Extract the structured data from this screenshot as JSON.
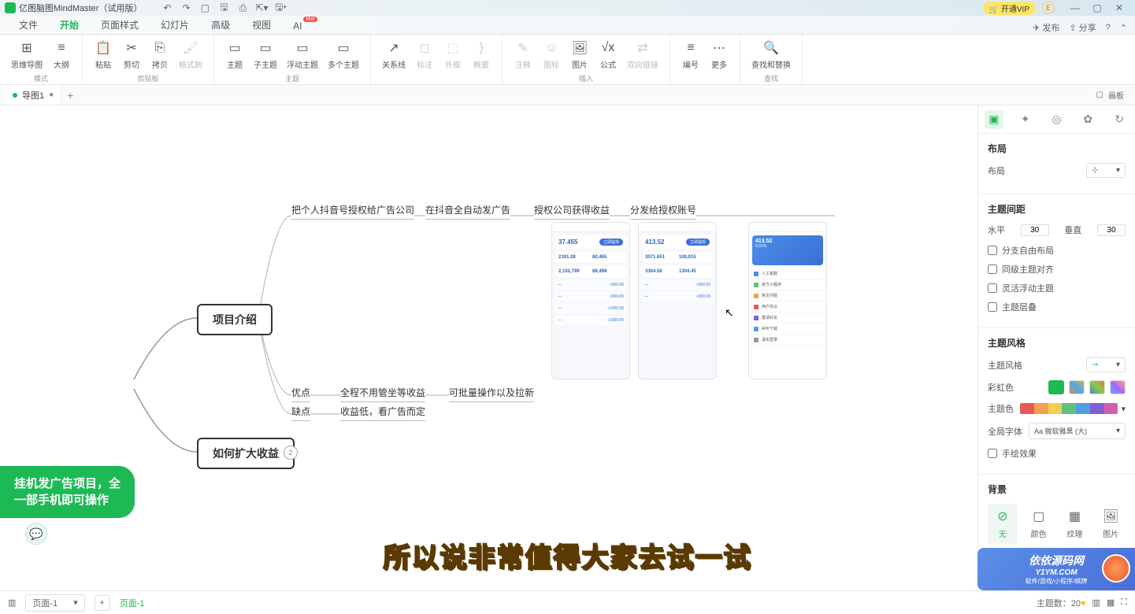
{
  "titlebar": {
    "app_name": "亿图脑图MindMaster（试用版）",
    "vip_label": "开通VIP",
    "avatar_letter": "E"
  },
  "menu": {
    "items": [
      "文件",
      "开始",
      "页面样式",
      "幻灯片",
      "高级",
      "视图",
      "AI"
    ],
    "ai_badge": "Hot",
    "active_index": 1,
    "right": {
      "publish": "发布",
      "share": "分享"
    }
  },
  "ribbon": {
    "groups": [
      {
        "label": "模式",
        "tools": [
          {
            "name": "mindmap-mode",
            "label": "思维导图",
            "icon": "⊞"
          },
          {
            "name": "outline-mode",
            "label": "大纲",
            "icon": "≡"
          }
        ]
      },
      {
        "label": "剪贴板",
        "tools": [
          {
            "name": "paste",
            "label": "粘贴",
            "icon": "📋"
          },
          {
            "name": "cut",
            "label": "剪切",
            "icon": "✂"
          },
          {
            "name": "copy",
            "label": "拷贝",
            "icon": "⎘"
          },
          {
            "name": "format-painter",
            "label": "格式刷",
            "icon": "🖌",
            "disabled": true
          }
        ]
      },
      {
        "label": "主题",
        "tools": [
          {
            "name": "topic",
            "label": "主题",
            "icon": "▭"
          },
          {
            "name": "subtopic",
            "label": "子主题",
            "icon": "▭"
          },
          {
            "name": "floating-topic",
            "label": "浮动主题",
            "icon": "▭"
          },
          {
            "name": "multi-topic",
            "label": "多个主题",
            "icon": "▭"
          }
        ]
      },
      {
        "label": "",
        "tools": [
          {
            "name": "relation",
            "label": "关系线",
            "icon": "↗"
          },
          {
            "name": "callout",
            "label": "标注",
            "icon": "◻",
            "disabled": true
          },
          {
            "name": "boundary",
            "label": "外框",
            "icon": "⬚",
            "disabled": true
          },
          {
            "name": "summary",
            "label": "概要",
            "icon": "}",
            "disabled": true
          }
        ]
      },
      {
        "label": "插入",
        "tools": [
          {
            "name": "comment",
            "label": "注释",
            "icon": "✎",
            "disabled": true
          },
          {
            "name": "icon-insert",
            "label": "图标",
            "icon": "☺",
            "disabled": true
          },
          {
            "name": "image",
            "label": "图片",
            "icon": "🖼"
          },
          {
            "name": "formula",
            "label": "公式",
            "icon": "√x"
          },
          {
            "name": "bilink",
            "label": "双向链接",
            "icon": "⇄",
            "disabled": true
          }
        ]
      },
      {
        "label": "",
        "tools": [
          {
            "name": "numbering",
            "label": "编号",
            "icon": "≡"
          },
          {
            "name": "more",
            "label": "更多",
            "icon": "⋯"
          }
        ]
      },
      {
        "label": "查找",
        "tools": [
          {
            "name": "find-replace",
            "label": "查找和替换",
            "icon": "🔍"
          }
        ]
      }
    ]
  },
  "doctabs": {
    "tab_name": "导图1",
    "right_label": "画板"
  },
  "mindmap": {
    "root": "挂机发广告项目，全\n一部手机即可操作",
    "branch1": "项目介绍",
    "branch2": "如何扩大收益",
    "branch2_badge": "2",
    "row1": [
      "把个人抖音号授权给广告公司",
      "在抖音全自动发广告",
      "授权公司获得收益",
      "分发给授权账号"
    ],
    "row2_label": "优点",
    "row2_items": [
      "全程不用管坐等收益",
      "可批量操作以及拉新"
    ],
    "row3_label": "缺点",
    "row3_items": [
      "收益低，看广告而定"
    ],
    "mockup_values": {
      "m1_main": "37.455",
      "m1_sub1": "2191.28",
      "m1_sub2": "80,465",
      "m1_sub3": "2,102,799",
      "m1_sub4": "88,499",
      "m2_main": "413.52",
      "m2_sub1": "3071.651",
      "m2_sub2": "100,015",
      "m2_sub3": "3304.56",
      "m2_sub4": "1304.45",
      "m3_banner": "413.52",
      "m3_pct": "0.01%",
      "m3_items": [
        "人工客服",
        "官方小程序",
        "常见问题",
        "用户协议",
        "邀请好友",
        "APP下载",
        "退出登录"
      ]
    }
  },
  "rpanel": {
    "sections": {
      "layout": {
        "title": "布局",
        "layout_label": "布局"
      },
      "spacing": {
        "title": "主题间距",
        "h_label": "水平",
        "h_val": "30",
        "v_label": "垂直",
        "v_val": "30"
      },
      "checks": [
        "分支自由布局",
        "同级主题对齐",
        "灵活浮动主题",
        "主题层叠"
      ],
      "style": {
        "title": "主题风格",
        "style_label": "主题风格",
        "rainbow_label": "彩虹色",
        "theme_label": "主题色",
        "font_label": "全局字体",
        "font_value": "微软雅黑 (大)",
        "hand_label": "手绘效果"
      },
      "bg": {
        "title": "背景",
        "options": [
          "无",
          "颜色",
          "纹理",
          "图片"
        ]
      }
    }
  },
  "statusbar": {
    "page_label": "页面-1",
    "page_link": "页面-1",
    "topic_count_label": "主题数：",
    "topic_count": "20"
  },
  "caption": "所以说非常值得大家去试一试",
  "watermark": {
    "title": "依依源码网",
    "url": "Y1YM.COM",
    "sub": "软件/游戏/小程序/棋牌"
  }
}
